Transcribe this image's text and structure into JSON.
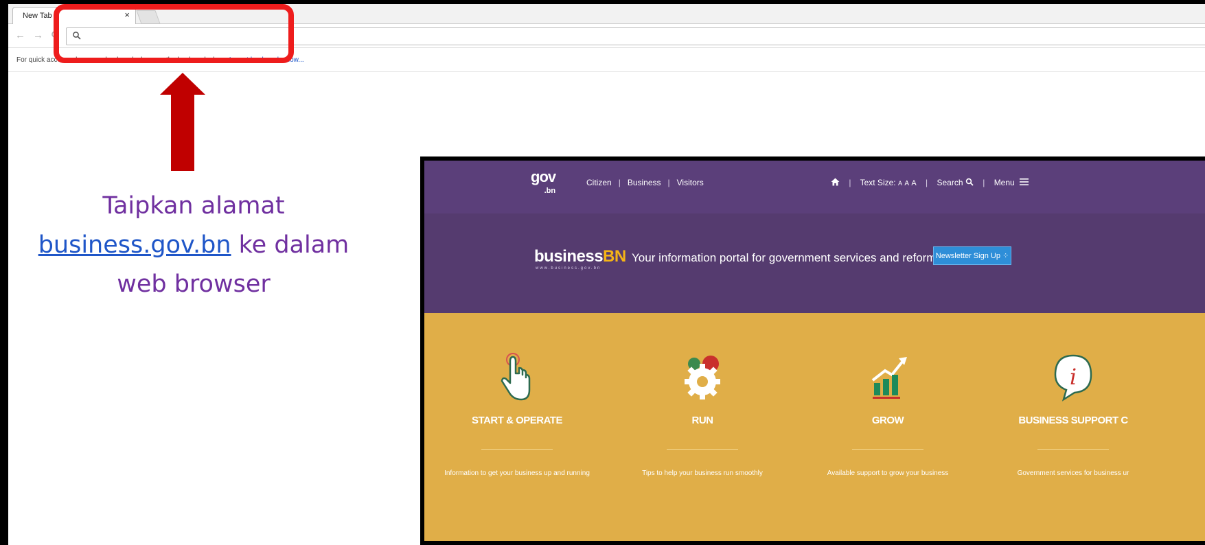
{
  "browser": {
    "tab_title": "New Tab",
    "tab_close": "×",
    "back": "←",
    "forward": "→",
    "address_value": "",
    "bookmarks_text": "For quick access, place your bookmarks here on the bookmarks bar.",
    "import_link": "Import bookmarks now..."
  },
  "instruction": {
    "line1": "Taipkan alamat",
    "link": "business.gov.bn",
    "line2_rest": " ke dalam",
    "line3": "web browser"
  },
  "site": {
    "logo_main": "gov",
    "logo_sub": ".bn",
    "nav": [
      "Citizen",
      "Business",
      "Visitors"
    ],
    "text_size_label": "Text Size:",
    "text_size_options": [
      "A",
      "A",
      "A"
    ],
    "search_label": "Search",
    "menu_label": "Menu",
    "brand_main": "business",
    "brand_accent": "BN",
    "brand_sub": "www.business.gov.bn",
    "tagline": "Your information portal for government services and reforms.",
    "newsletter": "Newsletter Sign Up",
    "tiles": [
      {
        "title": "START & OPERATE",
        "desc": "Information to get your business up and running",
        "icon": "hand-pointer-icon"
      },
      {
        "title": "RUN",
        "desc": "Tips to help your business run smoothly",
        "icon": "gears-icon"
      },
      {
        "title": "GROW",
        "desc": "Available support to grow your business",
        "icon": "growth-chart-icon"
      },
      {
        "title": "BUSINESS SUPPORT C",
        "desc": "Government services for business ur",
        "icon": "info-bubble-icon"
      }
    ]
  },
  "colors": {
    "highlight": "#ee1c1c",
    "arrow": "#c00000",
    "instruction_text": "#7030a0",
    "link": "#1f56c8",
    "site_nav": "#5b3f7a",
    "site_hero": "#553b6f",
    "site_tiles": "#e0ae48"
  }
}
